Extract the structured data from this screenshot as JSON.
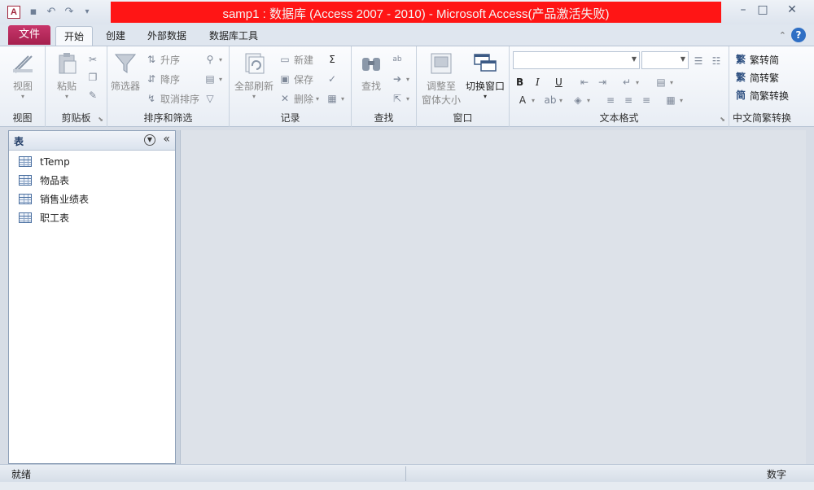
{
  "title_bar": {
    "app_icon_letter": "A",
    "title": "samp1 : 数据库 (Access 2007 - 2010) - Microsoft Access(产品激活失败)",
    "minimize": "–",
    "maximize": "□",
    "close": "✕"
  },
  "tabs": {
    "file": "文件",
    "items": [
      "开始",
      "创建",
      "外部数据",
      "数据库工具"
    ]
  },
  "ribbon": {
    "view": {
      "label": "视图",
      "group": "视图"
    },
    "clipboard": {
      "paste": "粘贴",
      "group": "剪贴板"
    },
    "sort_filter": {
      "filter": "筛选器",
      "ascending": "升序",
      "descending": "降序",
      "remove_sort": "取消排序",
      "group": "排序和筛选"
    },
    "records": {
      "refresh_all": "全部刷新",
      "new": "新建",
      "save": "保存",
      "delete": "删除",
      "group": "记录"
    },
    "find": {
      "find": "查找",
      "group": "查找"
    },
    "window": {
      "size_to_fit_line1": "调整至",
      "size_to_fit_line2": "窗体大小",
      "switch_windows": "切换窗口",
      "group": "窗口"
    },
    "text_format": {
      "bold": "B",
      "italic": "I",
      "underline": "U",
      "group": "文本格式"
    },
    "chinese_conversion": {
      "trad_to_simp": "繁转简",
      "simp_to_trad": "简转繁",
      "convert": "简繁转换",
      "group": "中文简繁转换"
    }
  },
  "nav_pane": {
    "header": "表",
    "collapse": "«",
    "items": [
      "tTemp",
      "物品表",
      "销售业绩表",
      "职工表"
    ]
  },
  "status_bar": {
    "left": "就绪",
    "right": "数字"
  }
}
